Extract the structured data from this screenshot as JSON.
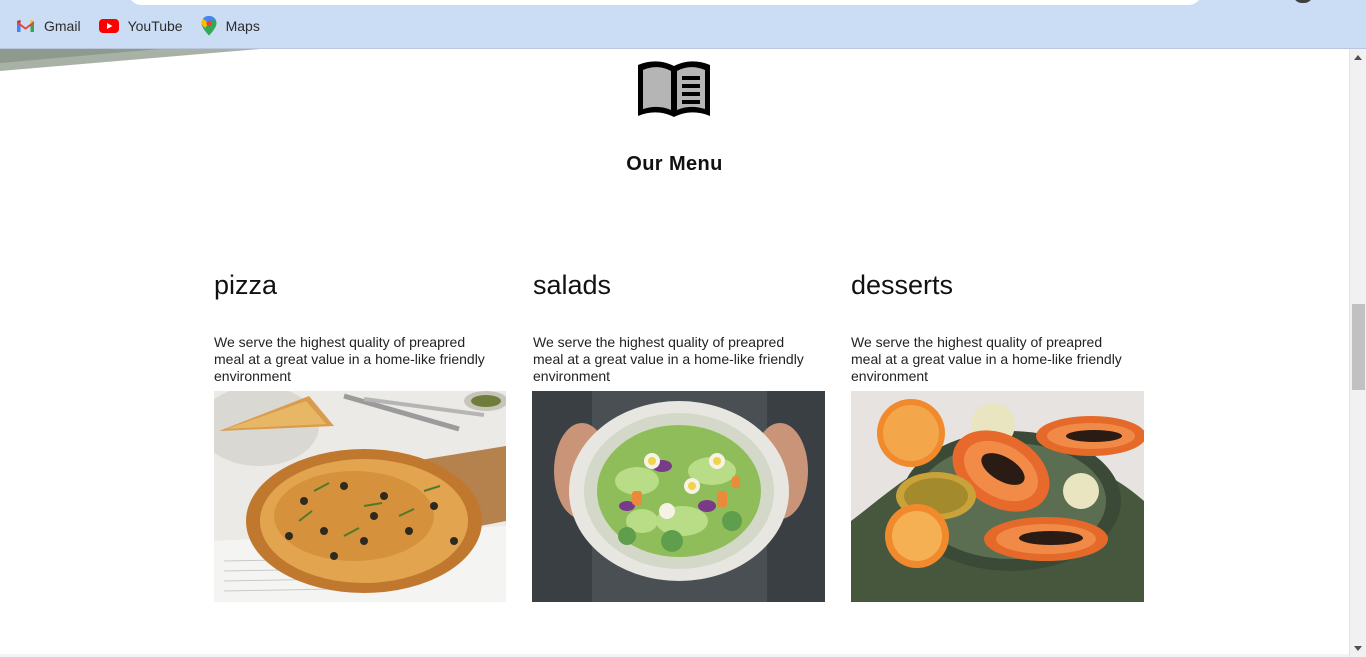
{
  "browser": {
    "bookmarks": [
      {
        "label": "Gmail",
        "icon": "gmail-icon"
      },
      {
        "label": "YouTube",
        "icon": "youtube-icon"
      },
      {
        "label": "Maps",
        "icon": "maps-icon"
      }
    ]
  },
  "section": {
    "icon": "open-book-icon",
    "title": "Our Menu"
  },
  "menu": {
    "items": [
      {
        "title": "pizza",
        "description": "We serve the highest quality of preapred meal at a great value in a home-like friendly environment",
        "image": "pizza-photo"
      },
      {
        "title": "salads",
        "description": "We serve the highest quality of preapred meal at a great value in a home-like friendly environment",
        "image": "salad-photo"
      },
      {
        "title": "desserts",
        "description": "We serve the highest quality of preapred meal at a great value in a home-like friendly environment",
        "image": "papaya-photo"
      }
    ]
  },
  "colors": {
    "browser_bar": "#cbdcf5",
    "page_background": "#ffffff",
    "text": "#111111"
  }
}
